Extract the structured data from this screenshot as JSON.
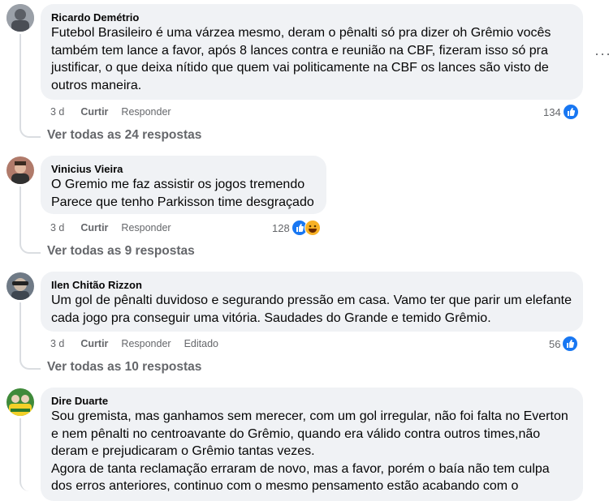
{
  "comments": [
    {
      "author": "Ricardo Demétrio",
      "text": "Futebol Brasileiro é uma várzea mesmo, deram o pênalti só pra dizer oh Grêmio vocês também tem lance a favor, após 8 lances contra e reunião na CBF, fizeram isso só pra justificar, o que deixa nítido que quem vai politicamente na CBF os lances são visto de outros maneira.",
      "time": "3 d",
      "like_label": "Curtir",
      "reply_label": "Responder",
      "edited_label": "",
      "reaction_count": "134",
      "reactions": [
        "like"
      ],
      "replies_label": "Ver todas as 24 respostas"
    },
    {
      "author": "Vinicius Vieira",
      "text_lines": [
        "O Gremio me faz assistir os jogos tremendo",
        "Parece que tenho Parkisson time desgraçado"
      ],
      "time": "3 d",
      "like_label": "Curtir",
      "reply_label": "Responder",
      "reaction_count": "128",
      "reactions": [
        "like",
        "haha"
      ],
      "replies_label": "Ver todas as 9 respostas"
    },
    {
      "author": "Ilen Chitão Rizzon",
      "text": "Um gol de pênalti duvidoso e segurando pressão em casa. Vamo ter que parir um elefante cada jogo pra conseguir uma vitória. Saudades do Grande e temido Grêmio.",
      "time": "3 d",
      "like_label": "Curtir",
      "reply_label": "Responder",
      "edited_label": "Editado",
      "reaction_count": "56",
      "reactions": [
        "like"
      ],
      "replies_label": "Ver todas as 10 respostas"
    },
    {
      "author": "Dire Duarte",
      "text_lines": [
        "Sou gremista, mas ganhamos sem merecer, com um gol irregular, não foi falta no Everton e nem pênalti no centroavante do Grêmio, quando era válido contra outros times,não deram e prejudicaram o Grêmio tantas vezes.",
        "Agora de tanta reclamação erraram de novo, mas a favor, porém o baía não tem culpa dos erros anteriores, continuo com o mesmo pensamento estão acabando com o"
      ]
    }
  ],
  "more_icon": "more-horizontal-icon",
  "colors": {
    "bubble": "#f0f2f5",
    "secondary_text": "#65676b",
    "like_blue": "#1877f2",
    "haha_yellow": "#f7b125"
  }
}
